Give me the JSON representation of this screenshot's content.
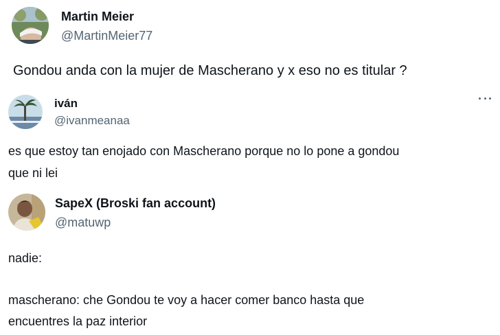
{
  "tweets": [
    {
      "display_name": "Martin Meier",
      "handle": "@MartinMeier77",
      "avatar_icon": "profile-photo-man-cap",
      "text_lines": [
        "Gondou anda con la mujer de Mascherano y x eso no es titular ?"
      ]
    },
    {
      "display_name": "iván",
      "handle": "@ivanmeanaa",
      "avatar_icon": "profile-photo-palm-tree",
      "more_icon": "more-options-icon",
      "text_lines": [
        "es que estoy tan enojado con Mascherano porque no lo pone a gondou",
        "que ni lei"
      ]
    },
    {
      "display_name": "SapeX (Broski fan account)",
      "handle": "@matuwp",
      "avatar_icon": "profile-photo-person",
      "text_lines": [
        "nadie:",
        "mascherano: che Gondou te voy a hacer comer banco hasta que",
        "encuentres la paz interior"
      ]
    }
  ],
  "colors": {
    "text": "#0f1419",
    "secondary_text": "#536471",
    "background": "#ffffff"
  }
}
